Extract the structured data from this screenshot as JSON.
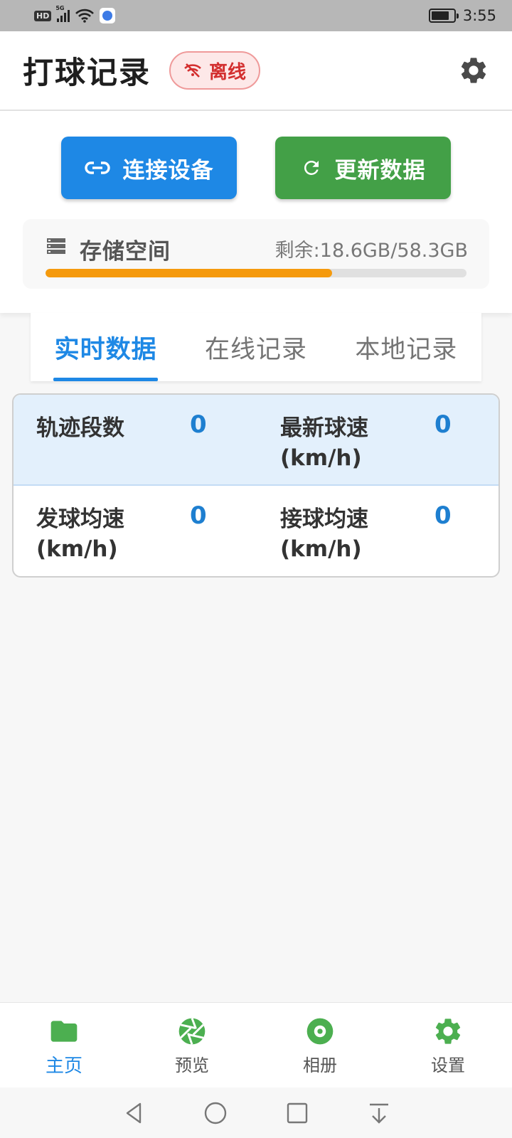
{
  "status_bar": {
    "network_badge": "HD",
    "signal_label": "5G",
    "time": "3:55"
  },
  "header": {
    "title": "打球记录",
    "status_badge": "离线",
    "settings_icon": "gear-icon"
  },
  "actions": {
    "connect_label": "连接设备",
    "connect_icon": "link-icon",
    "refresh_label": "更新数据",
    "refresh_icon": "refresh-icon"
  },
  "storage": {
    "title": "存储空间",
    "remaining_text": "剩余:18.6GB/58.3GB",
    "used_fraction": 0.68
  },
  "tabs": [
    {
      "label": "实时数据",
      "active": true
    },
    {
      "label": "在线记录",
      "active": false
    },
    {
      "label": "本地记录",
      "active": false
    }
  ],
  "stats": {
    "track_segments": {
      "label": "轨迹段数",
      "value": "0"
    },
    "latest_speed": {
      "label": "最新球速(km/h)",
      "value": "0"
    },
    "serve_avg_speed": {
      "label": "发球均速(km/h)",
      "value": "0"
    },
    "receive_avg_speed": {
      "label": "接球均速(km/h)",
      "value": "0"
    }
  },
  "bottom_nav": [
    {
      "label": "主页",
      "icon": "folder-icon",
      "active": true
    },
    {
      "label": "预览",
      "icon": "aperture-icon",
      "active": false
    },
    {
      "label": "相册",
      "icon": "disc-icon",
      "active": false
    },
    {
      "label": "设置",
      "icon": "gear-icon",
      "active": false
    }
  ],
  "colors": {
    "primary": "#1e88e5",
    "success": "#43a047",
    "warning": "#f59a0d",
    "error": "#d32f2f",
    "nav_icon": "#4caf50"
  }
}
